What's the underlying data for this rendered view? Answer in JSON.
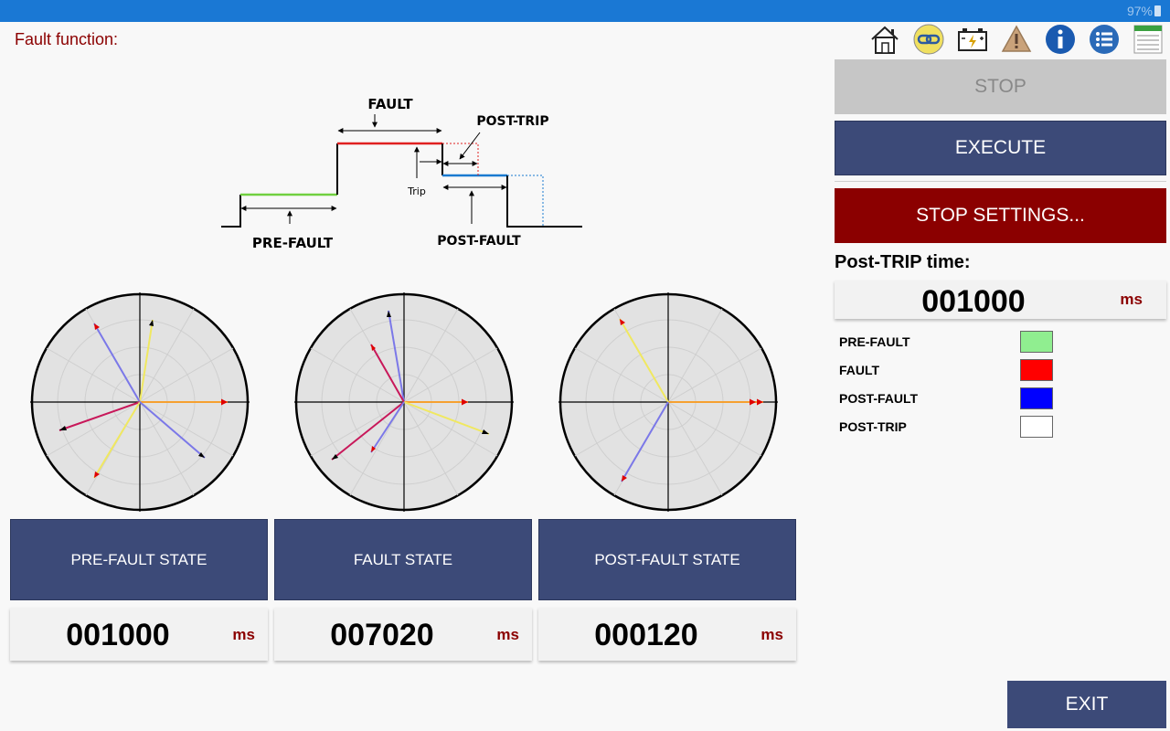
{
  "status_bar": {
    "battery": "97%"
  },
  "page_title": "Fault function:",
  "toolbar": {
    "icons": [
      "home-icon",
      "link-icon",
      "battery-icon",
      "warning-icon",
      "info-icon",
      "list-icon",
      "notes-icon"
    ]
  },
  "diagram": {
    "fault": "FAULT",
    "post_trip": "POST-TRIP",
    "trip": "Trip",
    "pre_fault": "PRE-FAULT",
    "post_fault": "POST-FAULT"
  },
  "states": [
    {
      "label": "PRE-FAULT STATE",
      "time": "001000",
      "unit": "ms"
    },
    {
      "label": "FAULT STATE",
      "time": "007020",
      "unit": "ms"
    },
    {
      "label": "POST-FAULT STATE",
      "time": "000120",
      "unit": "ms"
    }
  ],
  "phasor_colors": {
    "orange": "#f5a030",
    "yellow": "#f0e860",
    "blue": "#7b78e8",
    "crimson": "#c8185a",
    "red_tip": "#e00000",
    "black_tip": "#000000"
  },
  "controls": {
    "stop": "STOP",
    "execute": "EXECUTE",
    "stop_settings": "STOP SETTINGS...",
    "exit": "EXIT"
  },
  "post_trip": {
    "label": "Post-TRIP time:",
    "value": "001000",
    "unit": "ms"
  },
  "legend": [
    {
      "label": "PRE-FAULT",
      "color": "#90ee90"
    },
    {
      "label": "FAULT",
      "color": "#ff0000"
    },
    {
      "label": "POST-FAULT",
      "color": "#0000ff"
    },
    {
      "label": "POST-TRIP",
      "color": "#ffffff"
    }
  ]
}
